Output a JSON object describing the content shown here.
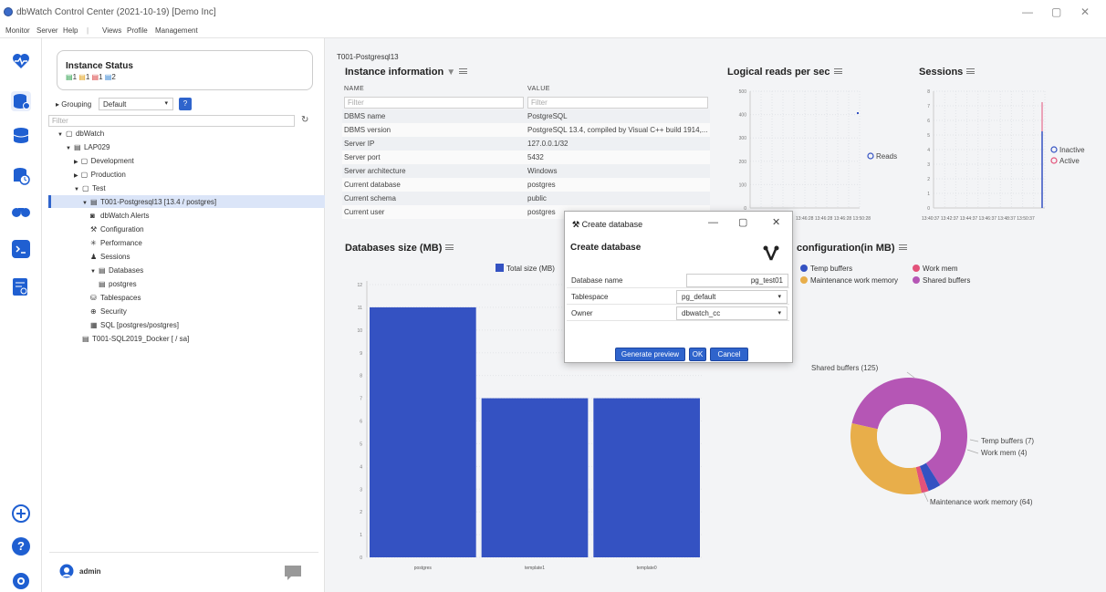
{
  "app": {
    "title": "dbWatch Control Center  (2021-10-19) [Demo Inc]",
    "menu": [
      "Monitor",
      "Server",
      "Help",
      "|",
      "Views",
      "Profile",
      "Management"
    ],
    "window_controls": {
      "minimize": "—",
      "maximize": "▢",
      "close": "✕"
    }
  },
  "colors": {
    "accent": "#2f64cc",
    "bar": "#3452c2",
    "shared": "#b556b5",
    "maint": "#e8ae4a",
    "temp": "#3452c2",
    "work": "#e3527a"
  },
  "instance_status": {
    "title": "Instance Status",
    "counts": [
      "1",
      "1",
      "1",
      "2"
    ]
  },
  "grouping": {
    "label": "Grouping",
    "value": "Default",
    "help": "?"
  },
  "filter_placeholder": "Filter",
  "tree": [
    {
      "label": "dbWatch",
      "indent": 0,
      "tri": "▼",
      "icon": "folder"
    },
    {
      "label": "LAP029",
      "indent": 1,
      "tri": "▼",
      "icon": "server"
    },
    {
      "label": "Development",
      "indent": 2,
      "tri": "▶",
      "icon": "folder"
    },
    {
      "label": "Production",
      "indent": 2,
      "tri": "▶",
      "icon": "folder"
    },
    {
      "label": "Test",
      "indent": 2,
      "tri": "▼",
      "icon": "folder"
    },
    {
      "label": "T001-Postgresql13 [13.4 / postgres]",
      "indent": 3,
      "tri": "▼",
      "icon": "db",
      "selected": true
    },
    {
      "label": "dbWatch Alerts",
      "indent": 4,
      "tri": "",
      "icon": "alert"
    },
    {
      "label": "Configuration",
      "indent": 4,
      "tri": "",
      "icon": "tools"
    },
    {
      "label": "Performance",
      "indent": 4,
      "tri": "",
      "icon": "perf"
    },
    {
      "label": "Sessions",
      "indent": 4,
      "tri": "",
      "icon": "user"
    },
    {
      "label": "Databases",
      "indent": 4,
      "tri": "▼",
      "icon": "db"
    },
    {
      "label": "postgres",
      "indent": 5,
      "tri": "",
      "icon": "db"
    },
    {
      "label": "Tablespaces",
      "indent": 4,
      "tri": "",
      "icon": "ts"
    },
    {
      "label": "Security",
      "indent": 4,
      "tri": "",
      "icon": "sec"
    },
    {
      "label": "SQL [postgres/postgres]",
      "indent": 4,
      "tri": "",
      "icon": "sql"
    },
    {
      "label": "T001-SQL2019_Docker [ / sa]",
      "indent": 3,
      "tri": "",
      "icon": "db"
    }
  ],
  "user": {
    "name": "admin"
  },
  "breadcrumb": "T001-Postgresql13",
  "instance_info": {
    "title": "Instance information",
    "col_name": "NAME",
    "col_value": "VALUE",
    "filter": "Filter",
    "rows": [
      [
        "DBMS name",
        "PostgreSQL"
      ],
      [
        "DBMS version",
        "PostgreSQL 13.4, compiled by Visual C++ build 1914,..."
      ],
      [
        "Server IP",
        "127.0.0.1/32"
      ],
      [
        "Server port",
        "5432"
      ],
      [
        "Server architecture",
        "Windows"
      ],
      [
        "Current database",
        "postgres"
      ],
      [
        "Current schema",
        "public"
      ],
      [
        "Current user",
        "postgres"
      ]
    ]
  },
  "logical_reads": {
    "title": "Logical reads per sec",
    "yticks": [
      "500",
      "400",
      "300",
      "200",
      "100",
      "0"
    ],
    "xticks": "13:46:28 13:46:28 13:46:28 13:50:28",
    "legend": "Reads"
  },
  "sessions": {
    "title": "Sessions",
    "yticks": [
      "8",
      "7",
      "6",
      "5",
      "4",
      "3",
      "2",
      "1",
      "0"
    ],
    "xticks": "13:40:37 13:42:37 13:44:37 13:46:37 13:48:37 13:50:37",
    "legend": [
      "Inactive",
      "Active"
    ]
  },
  "mem_config": {
    "title": "configuration(in MB)",
    "legend": [
      "Temp buffers",
      "Work mem",
      "Maintenance work memory",
      "Shared buffers"
    ],
    "labels": [
      "Shared buffers (125)",
      "Temp buffers (7)",
      "Work mem (4)",
      "Maintenance work memory (64)"
    ]
  },
  "dialog": {
    "window_title": "Create database",
    "heading": "Create database",
    "fields": [
      {
        "label": "Database name",
        "value": "pg_test01"
      },
      {
        "label": "Tablespace",
        "value": "pg_default"
      },
      {
        "label": "Owner",
        "value": "dbwatch_cc"
      }
    ],
    "buttons": {
      "preview": "Generate preview",
      "ok": "OK",
      "cancel": "Cancel"
    }
  },
  "chart_data": [
    {
      "type": "bar",
      "title": "Databases size (MB)",
      "legend": "Total size (MB)",
      "categories": [
        "postgres",
        "template1",
        "template0"
      ],
      "values": [
        11,
        7,
        7
      ],
      "ylim": [
        0,
        12
      ],
      "yticks": [
        "0",
        "1",
        "2",
        "3",
        "4",
        "5",
        "6",
        "7",
        "8",
        "9",
        "10",
        "11",
        "12"
      ]
    },
    {
      "type": "pie",
      "title": "configuration(in MB)",
      "categories": [
        "Shared buffers",
        "Temp buffers",
        "Work mem",
        "Maintenance work memory"
      ],
      "values": [
        125,
        7,
        4,
        64
      ]
    }
  ]
}
